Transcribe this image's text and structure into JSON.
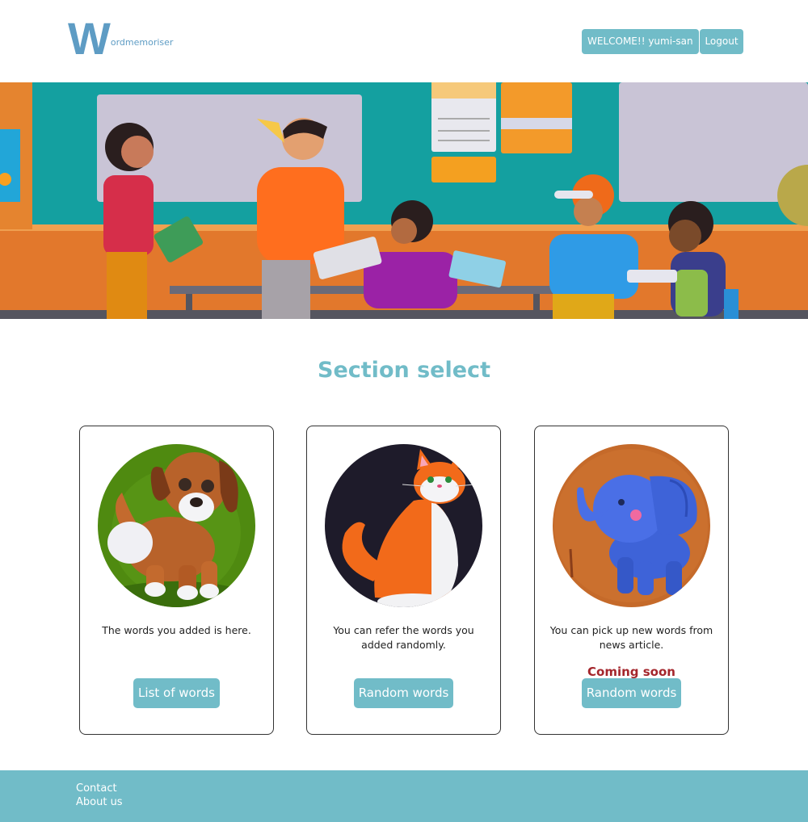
{
  "header": {
    "logo_initial": "W",
    "logo_text": "ordmemoriser",
    "welcome_label": "WELCOME!! yumi-san",
    "logout_label": "Logout"
  },
  "hero": {
    "image": "classroom-illustration"
  },
  "main": {
    "section_title": "Section select",
    "cards": [
      {
        "image": "puppy-illustration",
        "description": "The words you added is here.",
        "button_label": "List of words"
      },
      {
        "image": "cat-illustration",
        "description": "You can refer the words you added randomly.",
        "button_label": "Random words"
      },
      {
        "image": "elephant-illustration",
        "description": "You can pick up new words from news article.",
        "badge": "Coming soon",
        "button_label": "Random words"
      }
    ]
  },
  "footer": {
    "links": [
      "Contact",
      "About us"
    ]
  },
  "colors": {
    "accent": "#71bcc8",
    "logo": "#5e9cc4",
    "coming_soon": "#a4262c"
  }
}
